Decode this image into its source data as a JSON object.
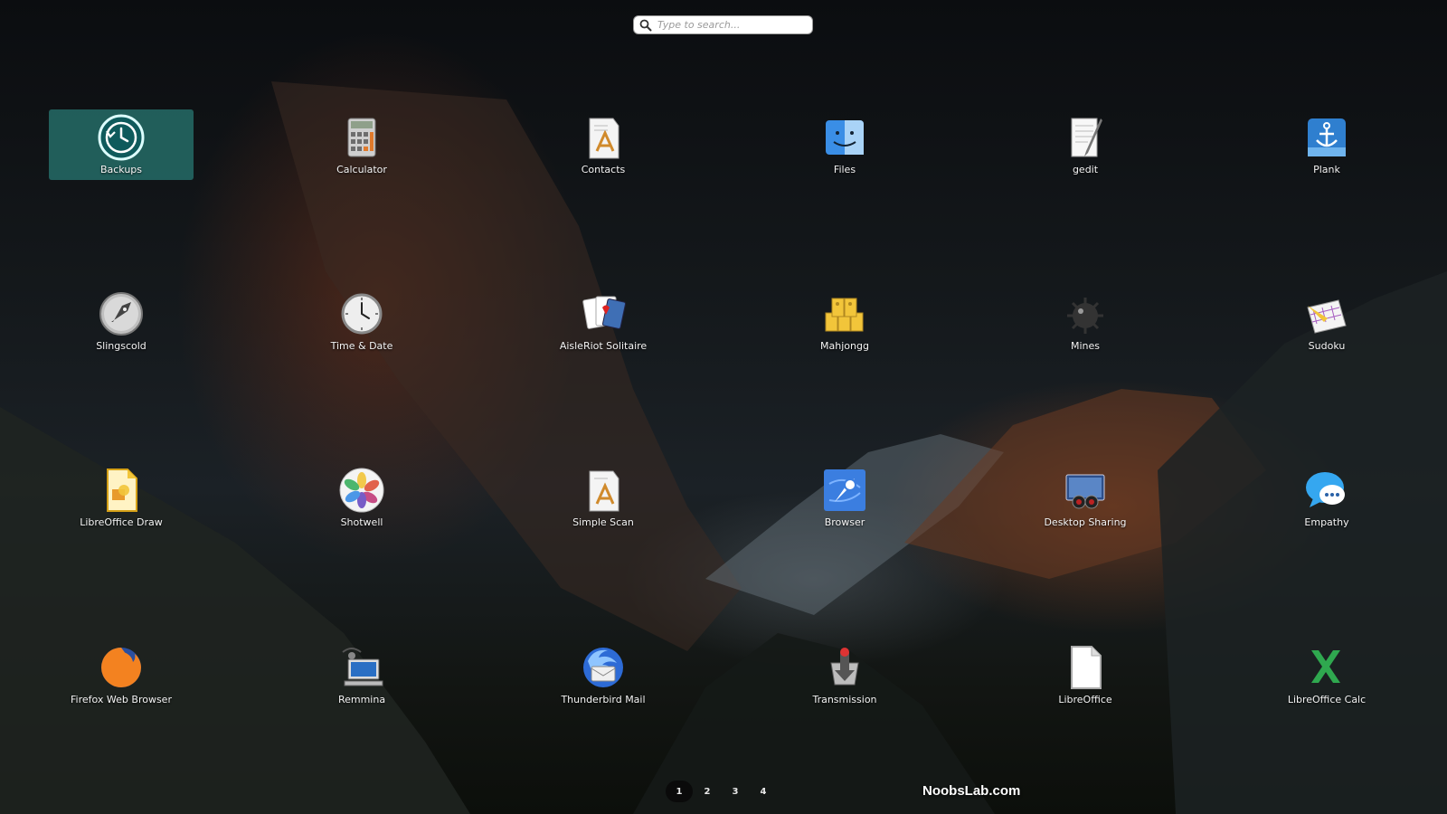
{
  "search": {
    "placeholder": "Type to search..."
  },
  "apps": [
    {
      "label": "Backups",
      "icon": "backups-icon",
      "selected": true
    },
    {
      "label": "Calculator",
      "icon": "calculator-icon"
    },
    {
      "label": "Contacts",
      "icon": "contacts-icon"
    },
    {
      "label": "Files",
      "icon": "files-icon"
    },
    {
      "label": "gedit",
      "icon": "gedit-icon"
    },
    {
      "label": "Plank",
      "icon": "plank-icon"
    },
    {
      "label": "Slingscold",
      "icon": "slingscold-icon"
    },
    {
      "label": "Time & Date",
      "icon": "clock-icon"
    },
    {
      "label": "AisleRiot Solitaire",
      "icon": "cards-icon"
    },
    {
      "label": "Mahjongg",
      "icon": "mahjongg-icon"
    },
    {
      "label": "Mines",
      "icon": "mine-icon"
    },
    {
      "label": "Sudoku",
      "icon": "sudoku-icon"
    },
    {
      "label": "LibreOffice Draw",
      "icon": "libreoffice-draw-icon"
    },
    {
      "label": "Shotwell",
      "icon": "shotwell-icon"
    },
    {
      "label": "Simple Scan",
      "icon": "simple-scan-icon"
    },
    {
      "label": "Browser",
      "icon": "browser-compass-icon"
    },
    {
      "label": "Desktop Sharing",
      "icon": "desktop-sharing-icon"
    },
    {
      "label": "Empathy",
      "icon": "empathy-chat-icon"
    },
    {
      "label": "Firefox Web Browser",
      "icon": "firefox-icon"
    },
    {
      "label": "Remmina",
      "icon": "remmina-icon"
    },
    {
      "label": "Thunderbird Mail",
      "icon": "thunderbird-icon"
    },
    {
      "label": "Transmission",
      "icon": "transmission-icon"
    },
    {
      "label": "LibreOffice",
      "icon": "libreoffice-icon"
    },
    {
      "label": "LibreOffice Calc",
      "icon": "libreoffice-calc-icon"
    }
  ],
  "pages": [
    "1",
    "2",
    "3",
    "4"
  ],
  "active_page": "1",
  "watermark": "NoobsLab.com",
  "colors": {
    "selection": "#26736e",
    "search_bg": "#ffffff",
    "page_active": "#0a0a0a"
  }
}
